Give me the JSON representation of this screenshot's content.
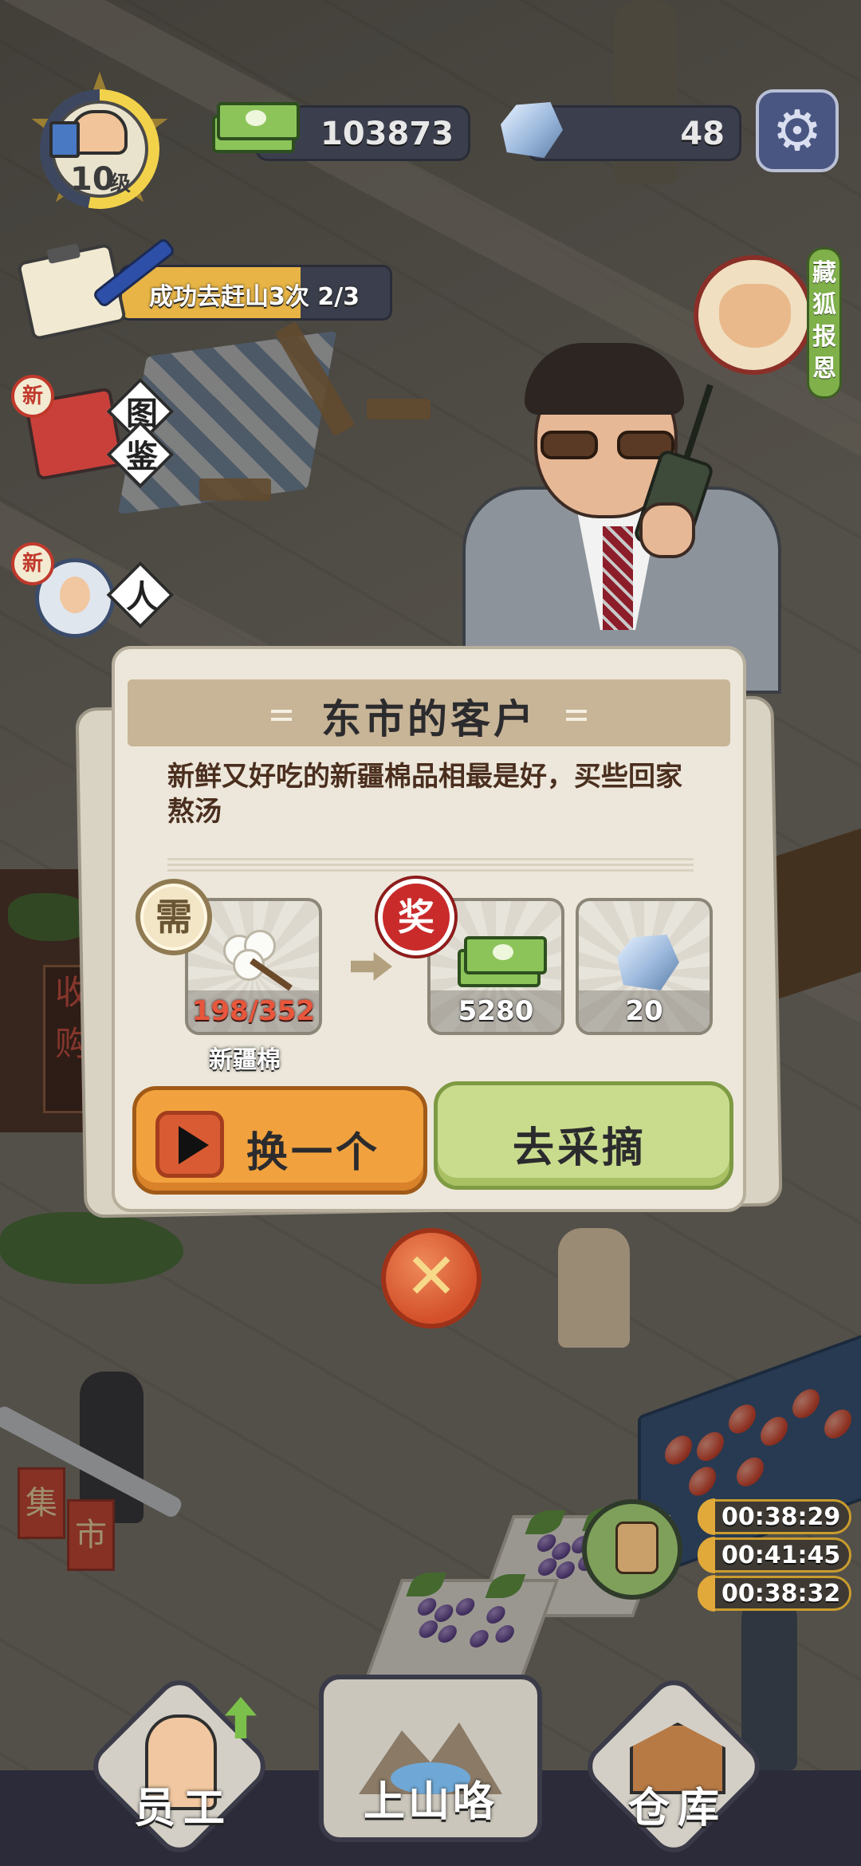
{
  "hud": {
    "level_number": "10",
    "level_unit": "级",
    "level_progress": 0.53,
    "money": "103873",
    "gems": "48",
    "task_text": "成功去赶山3次 2/3",
    "task_progress": 0.667
  },
  "side_buttons": {
    "book": {
      "badge": "新",
      "label_1": "图",
      "label_2": "鉴"
    },
    "people": {
      "badge": "新",
      "label_1": "人"
    },
    "fox": {
      "label": "藏狐报恩"
    }
  },
  "dialog": {
    "title": "东市的客户",
    "description": "新鲜又好吃的新疆棉品相最是好，买些回家熬汤",
    "need_stamp": "需",
    "reward_stamp": "奖",
    "need_item": {
      "name": "新疆棉",
      "count": "198/352",
      "icon": "cotton-icon"
    },
    "rewards": [
      {
        "icon": "money-icon",
        "count": "5280"
      },
      {
        "icon": "gem-icon",
        "count": "20"
      }
    ],
    "swap_button": "换一个",
    "pick_button": "去采摘",
    "close_glyph": "✕"
  },
  "scene": {
    "stall_sign": "收购",
    "market_sign": [
      "集",
      "市"
    ]
  },
  "timers": [
    "00:38:29",
    "00:41:45",
    "00:38:32"
  ],
  "nav": {
    "staff": "员工",
    "mountain": "上山咯",
    "warehouse": "仓库"
  },
  "colors": {
    "accent_orange": "#f1a23e",
    "accent_green": "#c9dc8d",
    "reward_red": "#c92b2b",
    "hud_dark": "#3b3f4d"
  }
}
